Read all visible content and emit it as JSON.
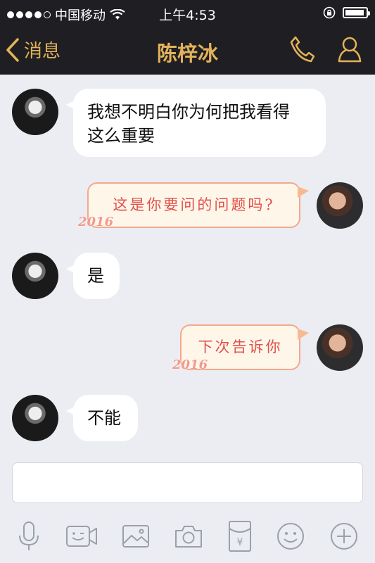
{
  "status_bar": {
    "carrier": "中国移动",
    "time": "上午4:53"
  },
  "nav": {
    "back_label": "消息",
    "title": "陈梓冰"
  },
  "messages": [
    {
      "side": "left",
      "text_line1": "我想不明白你为何把我看得",
      "text_line2": "这么重要"
    },
    {
      "side": "right",
      "text": "这是你要问的问题吗?",
      "badge": "2016"
    },
    {
      "side": "left",
      "text": "是"
    },
    {
      "side": "right",
      "text": "下次告诉你",
      "badge": "2016"
    },
    {
      "side": "left",
      "text": "不能"
    }
  ],
  "input": {
    "placeholder": ""
  },
  "toolbar": {
    "items": [
      "microphone-icon",
      "video-icon",
      "image-icon",
      "camera-icon",
      "red-packet-icon",
      "emoji-icon",
      "plus-icon"
    ],
    "red_packet_symbol": "¥"
  },
  "colors": {
    "accent": "#e3b25a",
    "nav_bg": "#1f1f23",
    "chat_bg": "#ebedf2",
    "bubble_text_right": "#e0514a"
  }
}
